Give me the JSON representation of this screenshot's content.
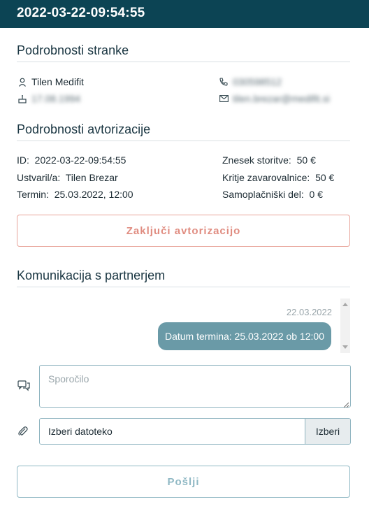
{
  "header": {
    "title": "2022-03-22-09:54:55"
  },
  "client": {
    "section_title": "Podrobnosti stranke",
    "name": "Tilen Medifit",
    "birthdate": "17.08.1994",
    "phone": "030598512",
    "email": "tilen.brezar@medifit.si",
    "icons": {
      "person": "person-icon",
      "cake": "cake-icon",
      "phone": "phone-icon",
      "mail": "mail-icon"
    }
  },
  "authorization": {
    "section_title": "Podrobnosti avtorizacije",
    "id_label": "ID:",
    "id_value": "2022-03-22-09:54:55",
    "created_label": "Ustvaril/a:",
    "created_value": "Tilen Brezar",
    "term_label": "Termin:",
    "term_value": "25.03.2022, 12:00",
    "amount_label": "Znesek storitve:",
    "amount_value": "50 €",
    "insurance_label": "Kritje zavarovalnice:",
    "insurance_value": "50 €",
    "selfpay_label": "Samoplačniški del:",
    "selfpay_value": "0 €",
    "close_button": "Zaključi avtorizacijo"
  },
  "communication": {
    "section_title": "Komunikacija s partnerjem",
    "messages": [
      {
        "date": "22.03.2022",
        "text": "Datum termina: 25.03.2022 ob 12:00"
      }
    ],
    "message_placeholder": "Sporočilo",
    "file_label": "Izberi datoteko",
    "file_button": "Izberi",
    "send_button": "Pošlji"
  },
  "colors": {
    "header_bg": "#0c4454",
    "bubble_bg": "#6a9aa7",
    "danger_outline": "#e8a49a",
    "primary_outline": "#8fb8c4"
  }
}
